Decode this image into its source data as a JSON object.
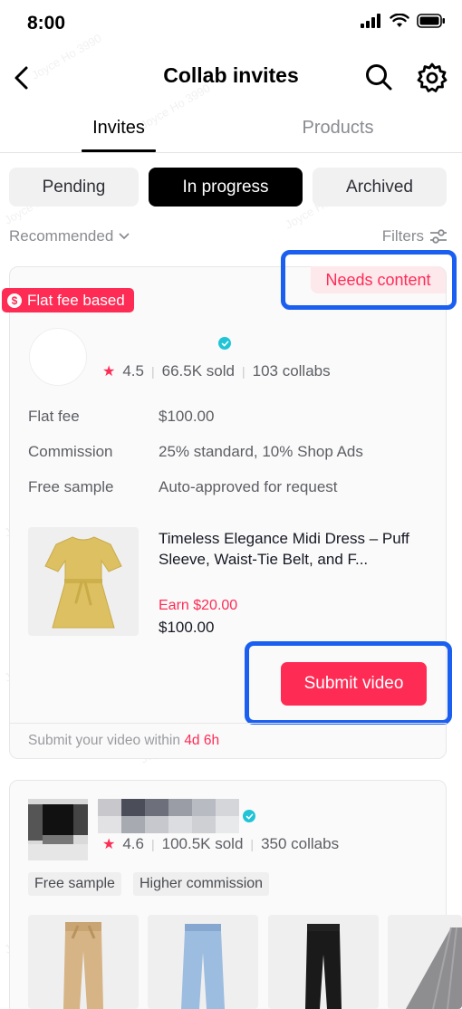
{
  "status_bar": {
    "time": "8:00"
  },
  "header": {
    "title": "Collab invites"
  },
  "tabs": [
    {
      "label": "Invites"
    },
    {
      "label": "Products"
    }
  ],
  "segments": [
    {
      "label": "Pending"
    },
    {
      "label": "In progress"
    },
    {
      "label": "Archived"
    }
  ],
  "sort": {
    "label": "Recommended"
  },
  "filters": {
    "label": "Filters"
  },
  "card1": {
    "status_badge": "Needs content",
    "fee_badge": "Flat fee based",
    "rating": "4.5",
    "sold": "66.5K sold",
    "collabs": "103 collabs",
    "details": [
      {
        "label": "Flat fee",
        "value": "$100.00"
      },
      {
        "label": "Commission",
        "value": "25% standard, 10% Shop Ads"
      },
      {
        "label": "Free sample",
        "value": "Auto-approved for request"
      }
    ],
    "product": {
      "title": "Timeless Elegance Midi Dress – Puff Sleeve, Waist-Tie Belt, and F...",
      "earn": "Earn $20.00",
      "price": "$100.00"
    },
    "submit_label": "Submit video",
    "deadline_prefix": "Submit your video within",
    "deadline_time": "4d 6h"
  },
  "card2": {
    "rating": "4.6",
    "sold": "100.5K sold",
    "collabs": "350 collabs",
    "tags": [
      "Free sample",
      "Higher commission"
    ]
  },
  "watermark": "Joyce Ho 3990",
  "colors": {
    "accent": "#fe2c55",
    "highlight": "#1a5ff0",
    "verified": "#20c4d6",
    "dress": "#dcc062"
  }
}
